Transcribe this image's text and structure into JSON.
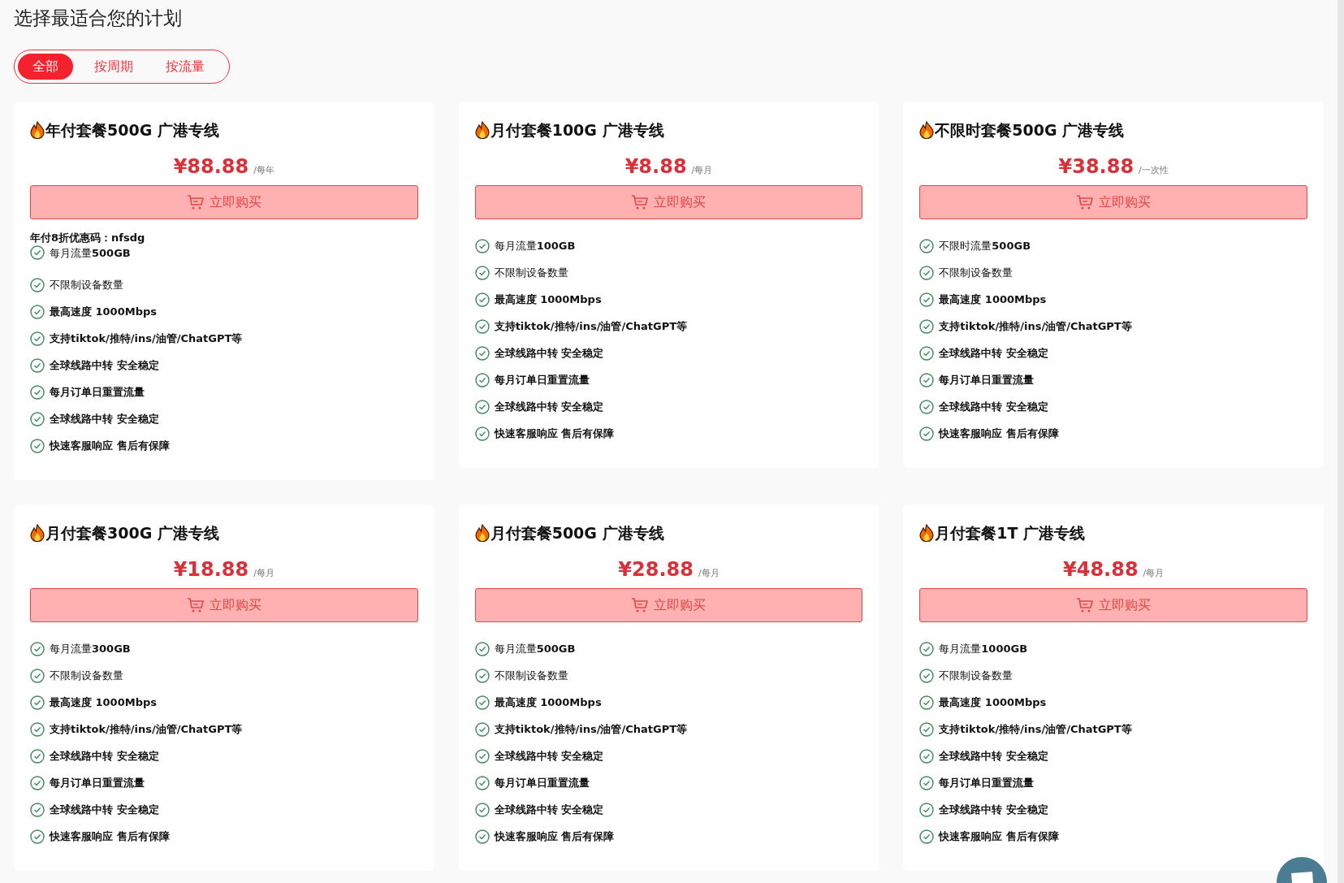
{
  "heading": "选择最适合您的计划",
  "tabs": [
    {
      "label": "全部",
      "selected": true
    },
    {
      "label": "按周期",
      "selected": false
    },
    {
      "label": "按流量",
      "selected": false
    }
  ],
  "plans": [
    {
      "title": "年付套餐500G 广港专线",
      "price": "¥88.88",
      "period": "/每年",
      "button": "立即购买",
      "note": "年付8折优惠码：nfsdg",
      "features": [
        {
          "text": "每月流量**500GB**",
          "bold": false
        },
        {
          "text": "不限制设备数量",
          "bold": false
        },
        {
          "text": "最高速度 1000Mbps",
          "bold": true
        },
        {
          "text": "支持tiktok/推特/ins/油管/ChatGPT等",
          "bold": true
        },
        {
          "text": "全球线路中转 安全稳定",
          "bold": true
        },
        {
          "text": "每月订单日重置流量",
          "bold": true
        },
        {
          "text": "全球线路中转 安全稳定",
          "bold": true
        },
        {
          "text": "快速客服响应 售后有保障",
          "bold": true
        }
      ]
    },
    {
      "title": "月付套餐100G 广港专线",
      "price": "¥8.88",
      "period": "/每月",
      "button": "立即购买",
      "features": [
        {
          "text": "每月流量**100GB**",
          "bold": false
        },
        {
          "text": "不限制设备数量",
          "bold": false
        },
        {
          "text": "最高速度 1000Mbps",
          "bold": true
        },
        {
          "text": "支持tiktok/推特/ins/油管/ChatGPT等",
          "bold": true
        },
        {
          "text": "全球线路中转 安全稳定",
          "bold": true
        },
        {
          "text": "每月订单日重置流量",
          "bold": true
        },
        {
          "text": "全球线路中转 安全稳定",
          "bold": true
        },
        {
          "text": "快速客服响应 售后有保障",
          "bold": true
        }
      ]
    },
    {
      "title": "不限时套餐500G 广港专线",
      "price": "¥38.88",
      "period": "/一次性",
      "button": "立即购买",
      "features": [
        {
          "text": "不限时流量**500GB**",
          "bold": false
        },
        {
          "text": "不限制设备数量",
          "bold": false
        },
        {
          "text": "最高速度 1000Mbps",
          "bold": true
        },
        {
          "text": "支持tiktok/推特/ins/油管/ChatGPT等",
          "bold": true
        },
        {
          "text": "全球线路中转 安全稳定",
          "bold": true
        },
        {
          "text": "每月订单日重置流量",
          "bold": true
        },
        {
          "text": "全球线路中转 安全稳定",
          "bold": true
        },
        {
          "text": "快速客服响应 售后有保障",
          "bold": true
        }
      ]
    },
    {
      "title": "月付套餐300G 广港专线",
      "price": "¥18.88",
      "period": "/每月",
      "button": "立即购买",
      "features": [
        {
          "text": "每月流量**300GB**",
          "bold": false
        },
        {
          "text": "不限制设备数量",
          "bold": false
        },
        {
          "text": "最高速度 1000Mbps",
          "bold": true
        },
        {
          "text": "支持tiktok/推特/ins/油管/ChatGPT等",
          "bold": true
        },
        {
          "text": "全球线路中转 安全稳定",
          "bold": true
        },
        {
          "text": "每月订单日重置流量",
          "bold": true
        },
        {
          "text": "全球线路中转 安全稳定",
          "bold": true
        },
        {
          "text": "快速客服响应 售后有保障",
          "bold": true
        }
      ]
    },
    {
      "title": "月付套餐500G 广港专线",
      "price": "¥28.88",
      "period": "/每月",
      "button": "立即购买",
      "features": [
        {
          "text": "每月流量**500GB**",
          "bold": false
        },
        {
          "text": "不限制设备数量",
          "bold": false
        },
        {
          "text": "最高速度 1000Mbps",
          "bold": true
        },
        {
          "text": "支持tiktok/推特/ins/油管/ChatGPT等",
          "bold": true
        },
        {
          "text": "全球线路中转 安全稳定",
          "bold": true
        },
        {
          "text": "每月订单日重置流量",
          "bold": true
        },
        {
          "text": "全球线路中转 安全稳定",
          "bold": true
        },
        {
          "text": "快速客服响应 售后有保障",
          "bold": true
        }
      ]
    },
    {
      "title": "月付套餐1T 广港专线",
      "price": "¥48.88",
      "period": "/每月",
      "button": "立即购买",
      "features": [
        {
          "text": "每月流量**1000GB**",
          "bold": false
        },
        {
          "text": "不限制设备数量",
          "bold": false
        },
        {
          "text": "最高速度 1000Mbps",
          "bold": true
        },
        {
          "text": "支持tiktok/推特/ins/油管/ChatGPT等",
          "bold": true
        },
        {
          "text": "全球线路中转 安全稳定",
          "bold": true
        },
        {
          "text": "每月订单日重置流量",
          "bold": true
        },
        {
          "text": "全球线路中转 安全稳定",
          "bold": true
        },
        {
          "text": "快速客服响应 售后有保障",
          "bold": true
        }
      ]
    }
  ]
}
